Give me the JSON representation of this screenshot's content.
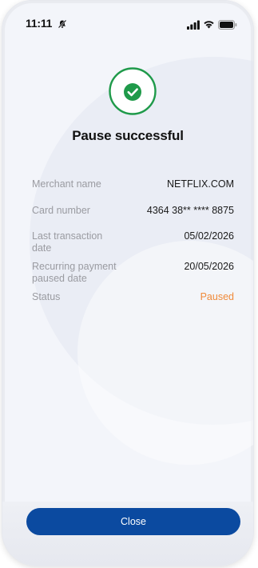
{
  "status_bar": {
    "time": "11:11",
    "icons": [
      "bell-off-icon",
      "signal-icon",
      "wifi-icon",
      "battery-icon"
    ]
  },
  "header": {
    "success_icon": "check-circle-icon",
    "title": "Pause successful"
  },
  "details": [
    {
      "label": "Merchant name",
      "value": "NETFLIX.COM"
    },
    {
      "label": "Card number",
      "value": "4364 38** **** 8875"
    },
    {
      "label": "Last transaction date",
      "value": "05/02/2026"
    },
    {
      "label": "Recurring payment paused date",
      "value": "20/05/2026"
    },
    {
      "label": "Status",
      "value": "Paused"
    }
  ],
  "actions": {
    "close_label": "Close"
  },
  "colors": {
    "accent": "#0b4aa0",
    "success": "#1f9a4a",
    "status_paused": "#f08a3a"
  }
}
